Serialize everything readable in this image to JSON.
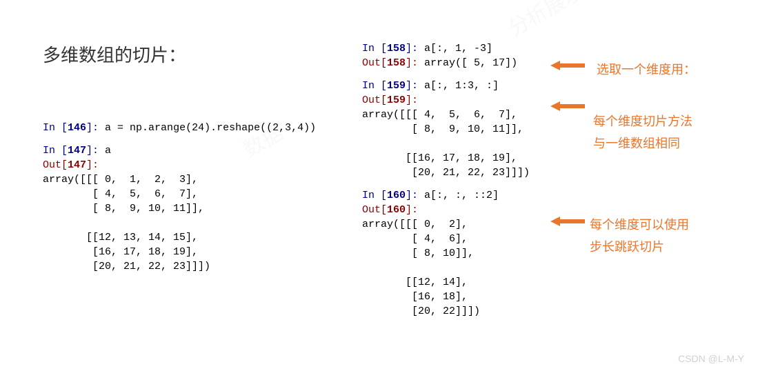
{
  "title": "多维数组的切片：",
  "left": {
    "in146": {
      "pre": "In [",
      "num": "146",
      "post": "]: ",
      "code": "a = np.arange(24).reshape((2,3,4))"
    },
    "in147": {
      "pre": "In [",
      "num": "147",
      "post": "]: ",
      "code": "a"
    },
    "out147": {
      "pre": "Out[",
      "num": "147",
      "post": "]:"
    },
    "arr147": "array([[[ 0,  1,  2,  3],\n        [ 4,  5,  6,  7],\n        [ 8,  9, 10, 11]],\n\n       [[12, 13, 14, 15],\n        [16, 17, 18, 19],\n        [20, 21, 22, 23]]])"
  },
  "right": {
    "in158": {
      "pre": "In [",
      "num": "158",
      "post": "]: ",
      "code": "a[:, 1, -3]"
    },
    "out158": {
      "pre": "Out[",
      "num": "158",
      "post": "]: ",
      "val": "array([ 5, 17])"
    },
    "in159": {
      "pre": "In [",
      "num": "159",
      "post": "]: ",
      "code": "a[:, 1:3, :]"
    },
    "out159": {
      "pre": "Out[",
      "num": "159",
      "post": "]:"
    },
    "arr159": "array([[[ 4,  5,  6,  7],\n        [ 8,  9, 10, 11]],\n\n       [[16, 17, 18, 19],\n        [20, 21, 22, 23]]])",
    "in160": {
      "pre": "In [",
      "num": "160",
      "post": "]: ",
      "code": "a[:, :, ::2]"
    },
    "out160": {
      "pre": "Out[",
      "num": "160",
      "post": "]:"
    },
    "arr160": "array([[[ 0,  2],\n        [ 4,  6],\n        [ 8, 10]],\n\n       [[12, 14],\n        [16, 18],\n        [20, 22]]])"
  },
  "annotations": {
    "a1": "选取一个维度用：",
    "a2_l1": "每个维度切片方法",
    "a2_l2": "与一维数组相同",
    "a3_l1": "每个维度可以使用",
    "a3_l2": "步长跳跃切片"
  },
  "watermarks": {
    "w1": "分析展示",
    "w2": "数据"
  },
  "footer": "CSDN @L-M-Y",
  "colors": {
    "in": "#000080",
    "out": "#8b0000",
    "ann": "#e8762d"
  }
}
